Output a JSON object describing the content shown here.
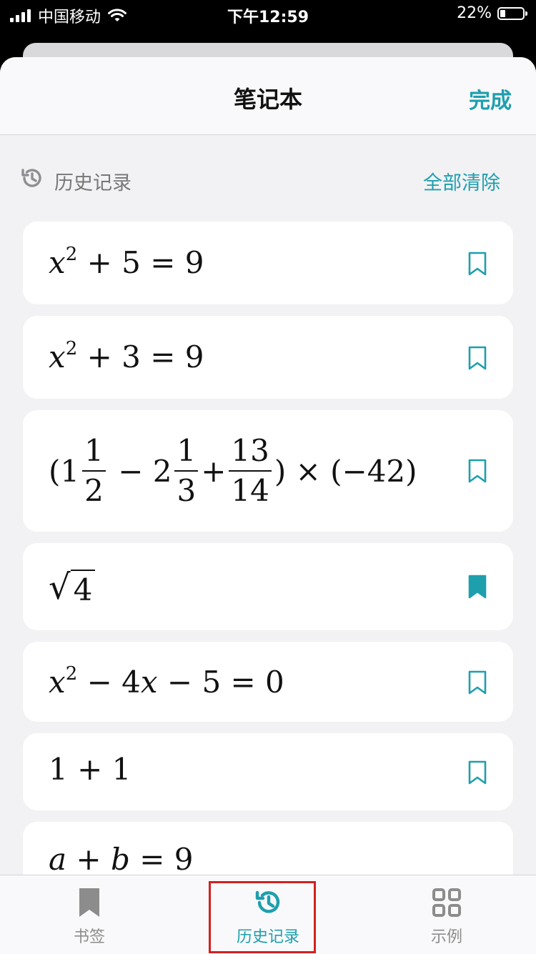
{
  "status_bar": {
    "carrier": "中国移动",
    "time": "下午12:59",
    "battery_text": "22%",
    "battery_level": 0.22
  },
  "nav": {
    "title": "笔记本",
    "done_label": "完成"
  },
  "section": {
    "label": "历史记录",
    "clear_label": "全部清除",
    "icon": "history-icon"
  },
  "history": [
    {
      "expression": "x^2 + 5 = 9",
      "bookmarked": false
    },
    {
      "expression": "x^2 + 3 = 9",
      "bookmarked": false
    },
    {
      "expression": "(1 1/2 − 2 1/3 + 13/14) × (−42)",
      "bookmarked": false
    },
    {
      "expression": "√4",
      "bookmarked": true
    },
    {
      "expression": "x^2 − 4x − 5 = 0",
      "bookmarked": false
    },
    {
      "expression": "1 + 1",
      "bookmarked": false
    },
    {
      "expression": "a + b = 9",
      "bookmarked": false
    }
  ],
  "tabs": [
    {
      "label": "书签",
      "icon": "bookmark-icon",
      "active": false
    },
    {
      "label": "历史记录",
      "icon": "history-icon",
      "active": true
    },
    {
      "label": "示例",
      "icon": "grid-icon",
      "active": false
    }
  ],
  "colors": {
    "accent": "#1e9fae",
    "highlight": "#d51f1f",
    "sheet_bg": "#f2f2f4"
  }
}
